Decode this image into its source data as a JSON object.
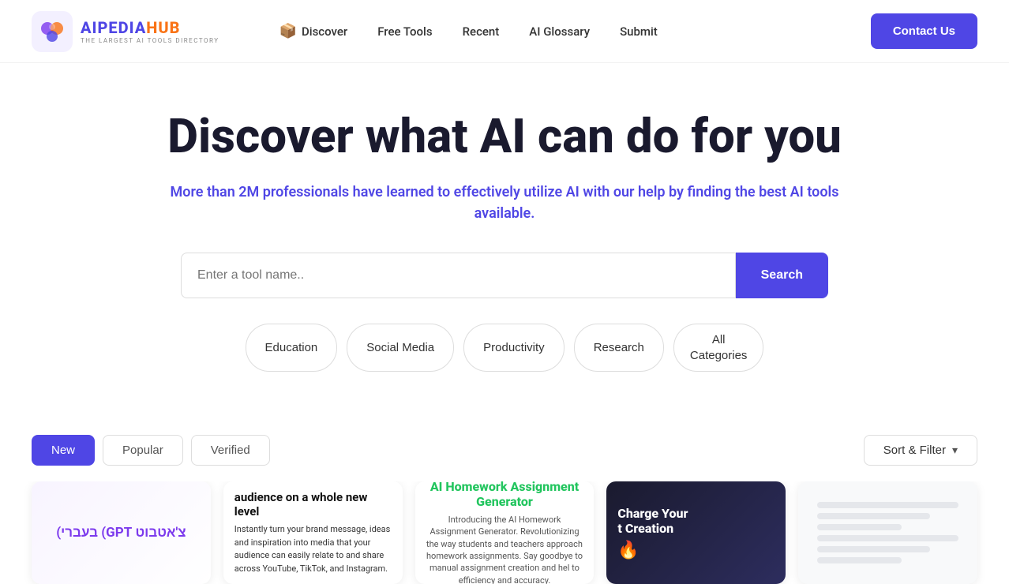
{
  "logo": {
    "name_part1": "AIPEDIA",
    "name_part2": "HUB",
    "subtitle": "THE LARGEST AI TOOLS DIRECTORY"
  },
  "nav": {
    "items": [
      {
        "label": "Discover",
        "has_icon": true
      },
      {
        "label": "Free Tools"
      },
      {
        "label": "Recent"
      },
      {
        "label": "AI Glossary"
      },
      {
        "label": "Submit"
      }
    ]
  },
  "header": {
    "contact_label": "Contact Us"
  },
  "hero": {
    "title": "Discover what AI can do for you",
    "subtitle": "More than 2M professionals have learned to effectively utilize AI with our help by finding the best AI tools available."
  },
  "search": {
    "placeholder": "Enter a tool name..",
    "button_label": "Search"
  },
  "categories": [
    {
      "label": "Education"
    },
    {
      "label": "Social Media"
    },
    {
      "label": "Productivity"
    },
    {
      "label": "Research"
    },
    {
      "label": "All\nCategories"
    }
  ],
  "filter_tabs": [
    {
      "label": "New",
      "active": true
    },
    {
      "label": "Popular",
      "active": false
    },
    {
      "label": "Verified",
      "active": false
    }
  ],
  "sort_filter": {
    "label": "Sort & Filter"
  },
  "cards": [
    {
      "id": "card-1",
      "text": "צ'אטבוט GPT) בעברי)"
    },
    {
      "id": "card-2",
      "title": "audience on a whole new level",
      "text": "Instantly turn your brand message, ideas and inspiration into media that your audience can easily relate to and share across YouTube, TikTok, and Instagram."
    },
    {
      "id": "card-3",
      "title_plain": "AI Homework",
      "title_highlight": "Assignment",
      "title_end": "Generator",
      "text": "Introducing the AI Homework Assignment Generator. Revolutionizing the way students and teachers approach homework assignments. Say goodbye to manual assignment creation and hel to efficiency and accuracy."
    },
    {
      "id": "card-4",
      "title_line1": "Charge Your",
      "title_line2": "t Creation",
      "emoji": "🔥"
    },
    {
      "id": "card-5"
    }
  ]
}
